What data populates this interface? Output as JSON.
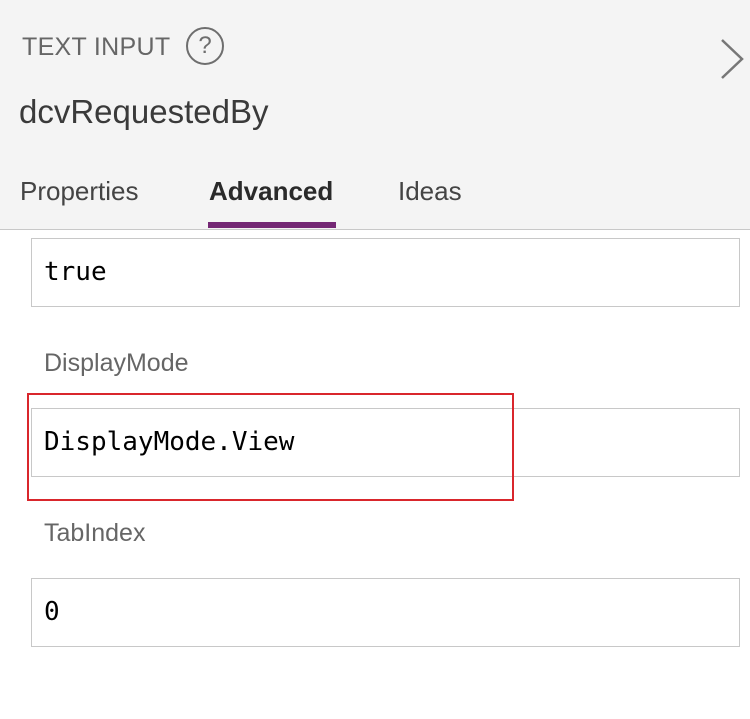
{
  "header": {
    "control_type": "TEXT INPUT",
    "help_icon_glyph": "?",
    "control_name": "dcvRequestedBy",
    "collapse_icon": "chevron-right-icon"
  },
  "tabs": [
    {
      "label": "Properties",
      "active": false
    },
    {
      "label": "Advanced",
      "active": true
    },
    {
      "label": "Ideas",
      "active": false
    }
  ],
  "accent_color": "#742774",
  "highlight_color": "#d9262c",
  "fields": {
    "previous": {
      "value": "true"
    },
    "display_mode": {
      "label": "DisplayMode",
      "value": "DisplayMode.View"
    },
    "tab_index": {
      "label": "TabIndex",
      "value": "0"
    }
  }
}
